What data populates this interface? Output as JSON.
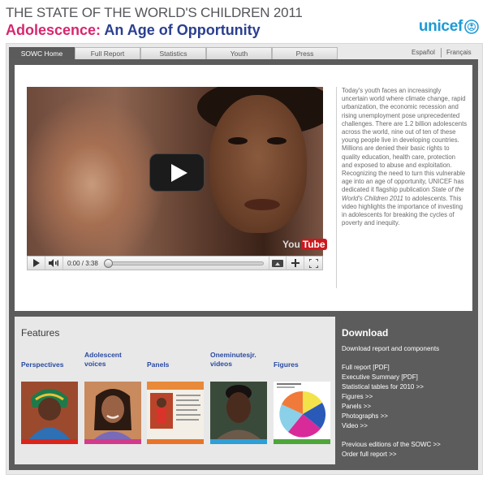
{
  "header": {
    "title": "THE STATE OF THE WORLD'S CHILDREN 2011",
    "subtitle_pink": "Adolescence:",
    "subtitle_rest": " An Age of Opportunity",
    "logo_text": "unicef"
  },
  "tabs": [
    {
      "label": "SOWC Home",
      "active": true
    },
    {
      "label": "Full Report"
    },
    {
      "label": "Statistics"
    },
    {
      "label": "Youth"
    },
    {
      "label": "Press"
    }
  ],
  "languages": [
    "Español",
    "Français"
  ],
  "video": {
    "time": "0:00 / 3:38",
    "logo_you": "You",
    "logo_tube": "Tube",
    "progress": 0
  },
  "description": {
    "text": "Today's youth faces an increasingly uncertain world where climate change, rapid urbanization, the economic recession and rising unemployment pose unprecedented challenges. There are 1.2 billion adolescents across the world, nine out of ten of these young people live in developing countries. Millions are denied their basic rights to quality education, health care, protection and exposed to abuse and exploitation. Recognizing the need to turn this vulnerable age into an age of opportunity, UNICEF has dedicated it flagship publication ",
    "italic": "State of the World's Children 2011",
    "text_end": " to adolescents. This video highlights the importance of investing in adolescents for breaking the cycles of poverty and inequity."
  },
  "features": {
    "title": "Features",
    "items": [
      {
        "label": "Perspectives",
        "bar_color": "#d9261c"
      },
      {
        "label": "Adolescent voices",
        "bar_color": "#d23b8c"
      },
      {
        "label": "Panels",
        "bar_color": "#e8742a"
      },
      {
        "label": "Oneminutesjr. videos",
        "bar_color": "#2d9ed6"
      },
      {
        "label": "Figures",
        "bar_color": "#4ea53a"
      }
    ]
  },
  "download": {
    "title": "Download",
    "subtitle": "Download report and components",
    "links": [
      "Full report [PDF]",
      "Executive Summary [PDF]",
      "Statistical tables for 2010 >>",
      "Figures >>",
      "Panels >>",
      "Photographs >>",
      "Video >>"
    ],
    "links2": [
      "Previous editions of the SOWC >>",
      "Order full report >>"
    ]
  },
  "colors": {
    "brand_blue": "#2a3f8f",
    "brand_pink": "#d6276e",
    "unicef_blue": "#1c9ad6",
    "panel_gray": "#5c5c5c"
  }
}
